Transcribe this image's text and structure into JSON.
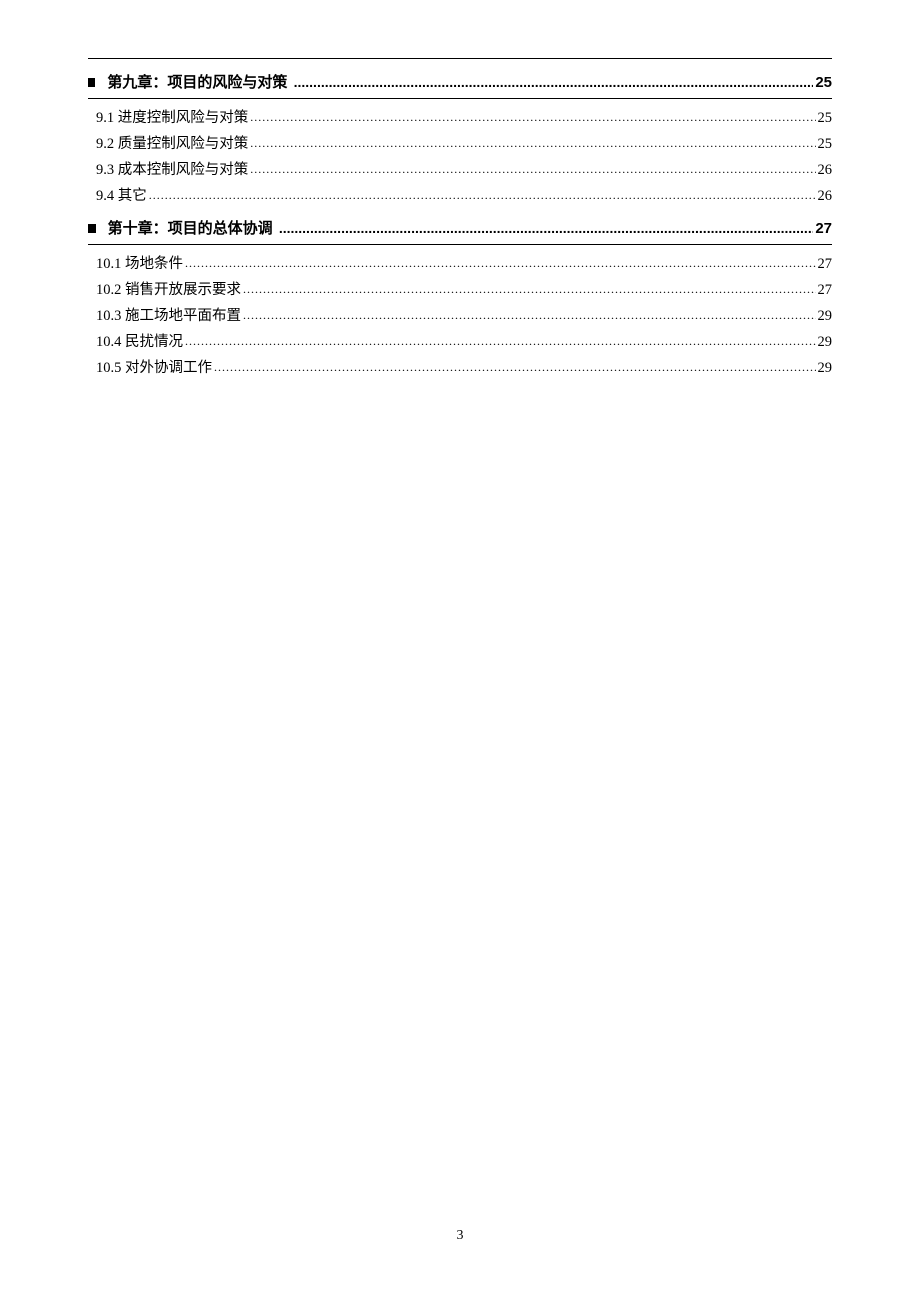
{
  "toc": {
    "chapter9": {
      "title": "第九章：项目的风险与对策",
      "page": "25",
      "items": [
        {
          "label": "9.1 进度控制风险与对策",
          "page": "25"
        },
        {
          "label": "9.2 质量控制风险与对策",
          "page": "25"
        },
        {
          "label": "9.3 成本控制风险与对策",
          "page": "26"
        },
        {
          "label": "9.4 其它",
          "page": "26"
        }
      ]
    },
    "chapter10": {
      "title": "第十章：项目的总体协调",
      "page": "27",
      "items": [
        {
          "label": "10.1 场地条件",
          "page": "27"
        },
        {
          "label": "10.2 销售开放展示要求",
          "page": "27"
        },
        {
          "label": "10.3 施工场地平面布置",
          "page": "29"
        },
        {
          "label": "10.4 民扰情况",
          "page": "29"
        },
        {
          "label": "10.5 对外协调工作",
          "page": "29"
        }
      ]
    }
  },
  "dotsFillBold": "..................................................................................................................................................................",
  "dotsFill": "..............................................................................................................................................................................................................................................................................................................................",
  "pageNumber": "3"
}
